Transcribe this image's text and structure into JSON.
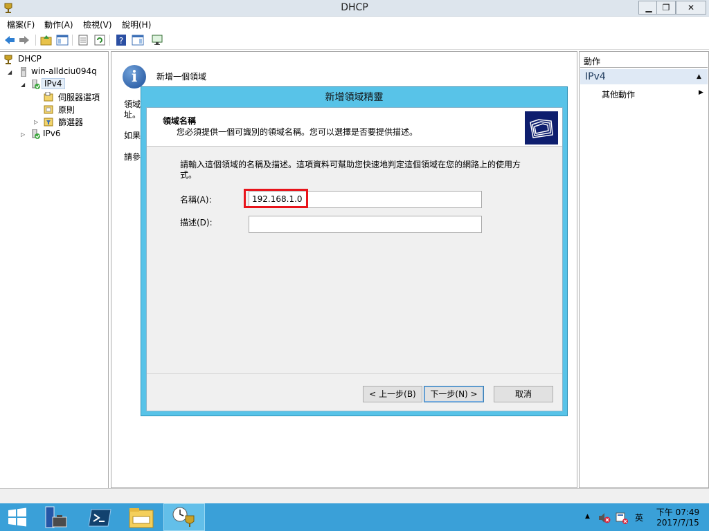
{
  "window": {
    "title": "DHCP",
    "minimize": "▁",
    "restore": "❐",
    "close": "✕"
  },
  "menu": [
    "檔案(F)",
    "動作(A)",
    "檢視(V)",
    "說明(H)"
  ],
  "tree": {
    "root": "DHCP",
    "server": "win-alldciu094q",
    "ipv4": "IPv4",
    "server_options": "伺服器選項",
    "policies": "原則",
    "filters": "篩選器",
    "ipv6": "IPv6"
  },
  "center": {
    "heading": "新增一個領域",
    "fragments": [
      "領域",
      "址。",
      "如果",
      "請參"
    ]
  },
  "actions": {
    "title": "動作",
    "section": "IPv4",
    "more": "其他動作"
  },
  "wizard": {
    "title": "新增領域精靈",
    "header_title": "領域名稱",
    "header_subtitle": "您必須提供一個可識別的領域名稱。您可以選擇是否要提供描述。",
    "description": "請輸入這個領域的名稱及描述。這項資料可幫助您快速地判定這個領域在您的網路上的使用方式。",
    "name_label": "名稱(A):",
    "name_value": "192.168.1.0",
    "desc_label": "描述(D):",
    "desc_value": "",
    "back_button": "< 上一步(B)",
    "next_button": "下一步(N) >",
    "cancel_button": "取消",
    "highlight_color": "#e8141b"
  },
  "taskbar": {
    "time": "下午 07:49",
    "date": "2017/7/15",
    "ime": "英",
    "tray_arrow": "▲"
  },
  "colors": {
    "wizard_frame": "#58c3e8",
    "taskbar": "#3aa0d8",
    "selected": "#e5eef8"
  }
}
